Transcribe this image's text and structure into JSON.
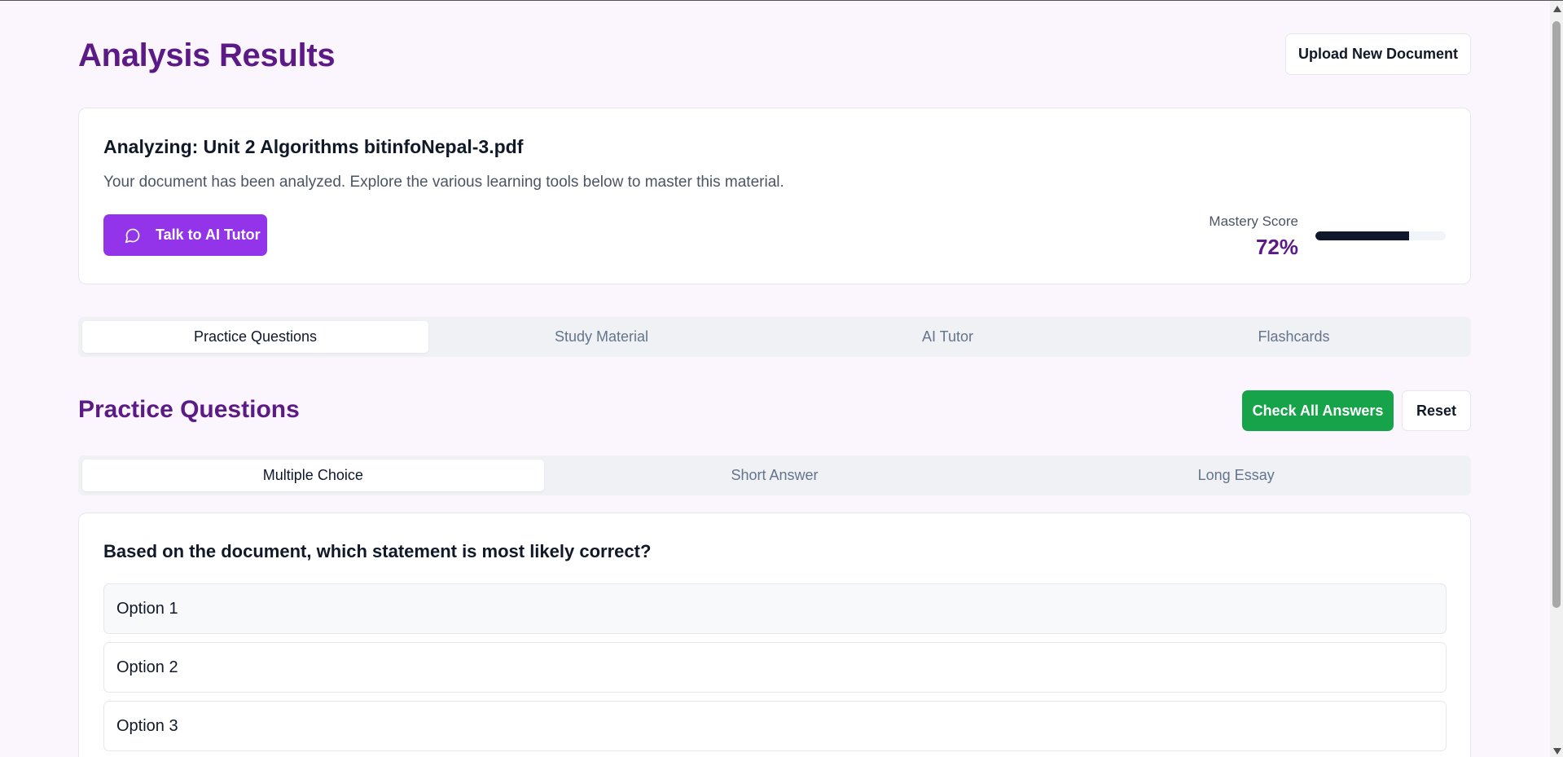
{
  "header": {
    "title": "Analysis Results",
    "upload_label": "Upload New Document"
  },
  "analysis": {
    "title": "Analyzing: Unit 2 Algorithms bitinfoNepal-3.pdf",
    "description": "Your document has been analyzed. Explore the various learning tools below to master this material.",
    "tutor_button_label": "Talk to AI Tutor",
    "mastery_label": "Mastery Score",
    "mastery_value": "72%",
    "mastery_fraction": 0.72
  },
  "main_tabs": [
    {
      "label": "Practice Questions",
      "active": true
    },
    {
      "label": "Study Material",
      "active": false
    },
    {
      "label": "AI Tutor",
      "active": false
    },
    {
      "label": "Flashcards",
      "active": false
    }
  ],
  "section": {
    "title": "Practice Questions",
    "check_label": "Check All Answers",
    "reset_label": "Reset"
  },
  "sub_tabs": [
    {
      "label": "Multiple Choice",
      "active": true
    },
    {
      "label": "Short Answer",
      "active": false
    },
    {
      "label": "Long Essay",
      "active": false
    }
  ],
  "question": {
    "text": "Based on the document, which statement is most likely correct?",
    "options": [
      "Option 1",
      "Option 2",
      "Option 3"
    ]
  },
  "colors": {
    "accent": "#9333ea",
    "heading": "#5b1a86",
    "success": "#16a34a"
  },
  "icons": {
    "tutor_button": "message-circle-icon"
  }
}
